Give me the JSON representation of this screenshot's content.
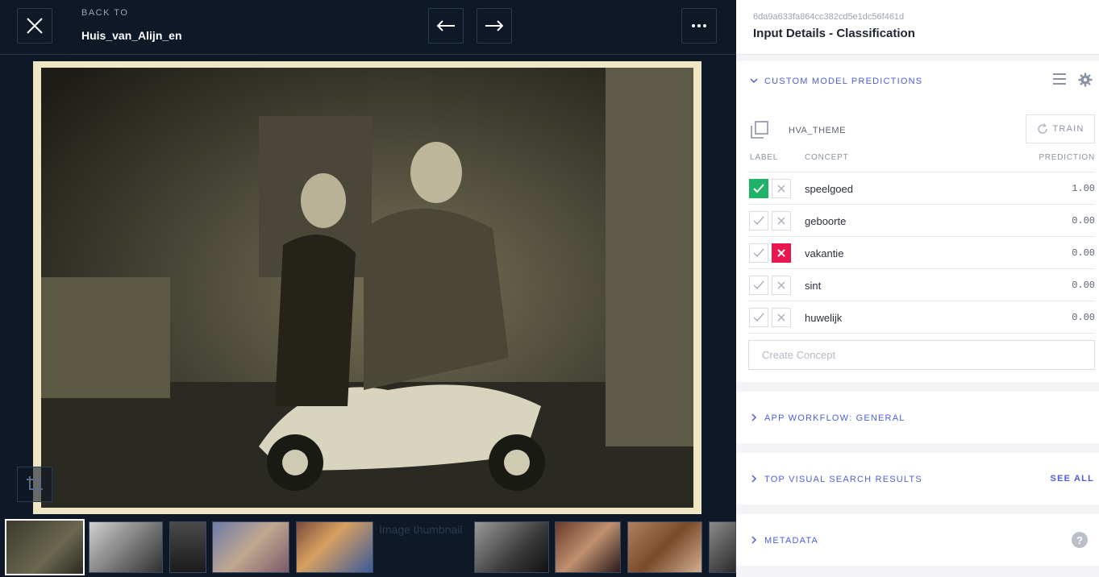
{
  "header": {
    "back_label": "BACK TO",
    "app_name": "Huis_van_Alijn_en",
    "close_icon": "close-icon",
    "prev_icon": "arrow-left-icon",
    "next_icon": "arrow-right-icon",
    "more_icon": "more-horizontal-icon"
  },
  "viewer": {
    "crop_icon": "crop-icon",
    "thumbnail_alt": "Image thumbnail"
  },
  "panel": {
    "input_id": "6da9a633fa864cc382cd5e1dc56f461d",
    "title": "Input Details - Classification",
    "custom_predictions": {
      "title": "CUSTOM MODEL PREDICTIONS",
      "model_name": "HVA_THEME",
      "train_label": "TRAIN",
      "columns": {
        "label": "LABEL",
        "concept": "CONCEPT",
        "prediction": "PREDICTION"
      },
      "rows": [
        {
          "concept": "speelgoed",
          "prediction": "1.00",
          "positive": true,
          "negative": false
        },
        {
          "concept": "geboorte",
          "prediction": "0.00",
          "positive": false,
          "negative": false
        },
        {
          "concept": "vakantie",
          "prediction": "0.00",
          "positive": false,
          "negative": true
        },
        {
          "concept": "sint",
          "prediction": "0.00",
          "positive": false,
          "negative": false
        },
        {
          "concept": "huwelijk",
          "prediction": "0.00",
          "positive": false,
          "negative": false
        }
      ],
      "create_placeholder": "Create Concept"
    },
    "app_workflow": {
      "title": "APP WORKFLOW: GENERAL"
    },
    "visual_search": {
      "title": "TOP VISUAL SEARCH RESULTS",
      "see_all": "SEE ALL"
    },
    "metadata": {
      "title": "METADATA"
    }
  },
  "colors": {
    "accent": "#4d5fd6",
    "positive": "#1fb36a",
    "negative": "#e8174d",
    "viewer_bg": "#0e1827"
  }
}
